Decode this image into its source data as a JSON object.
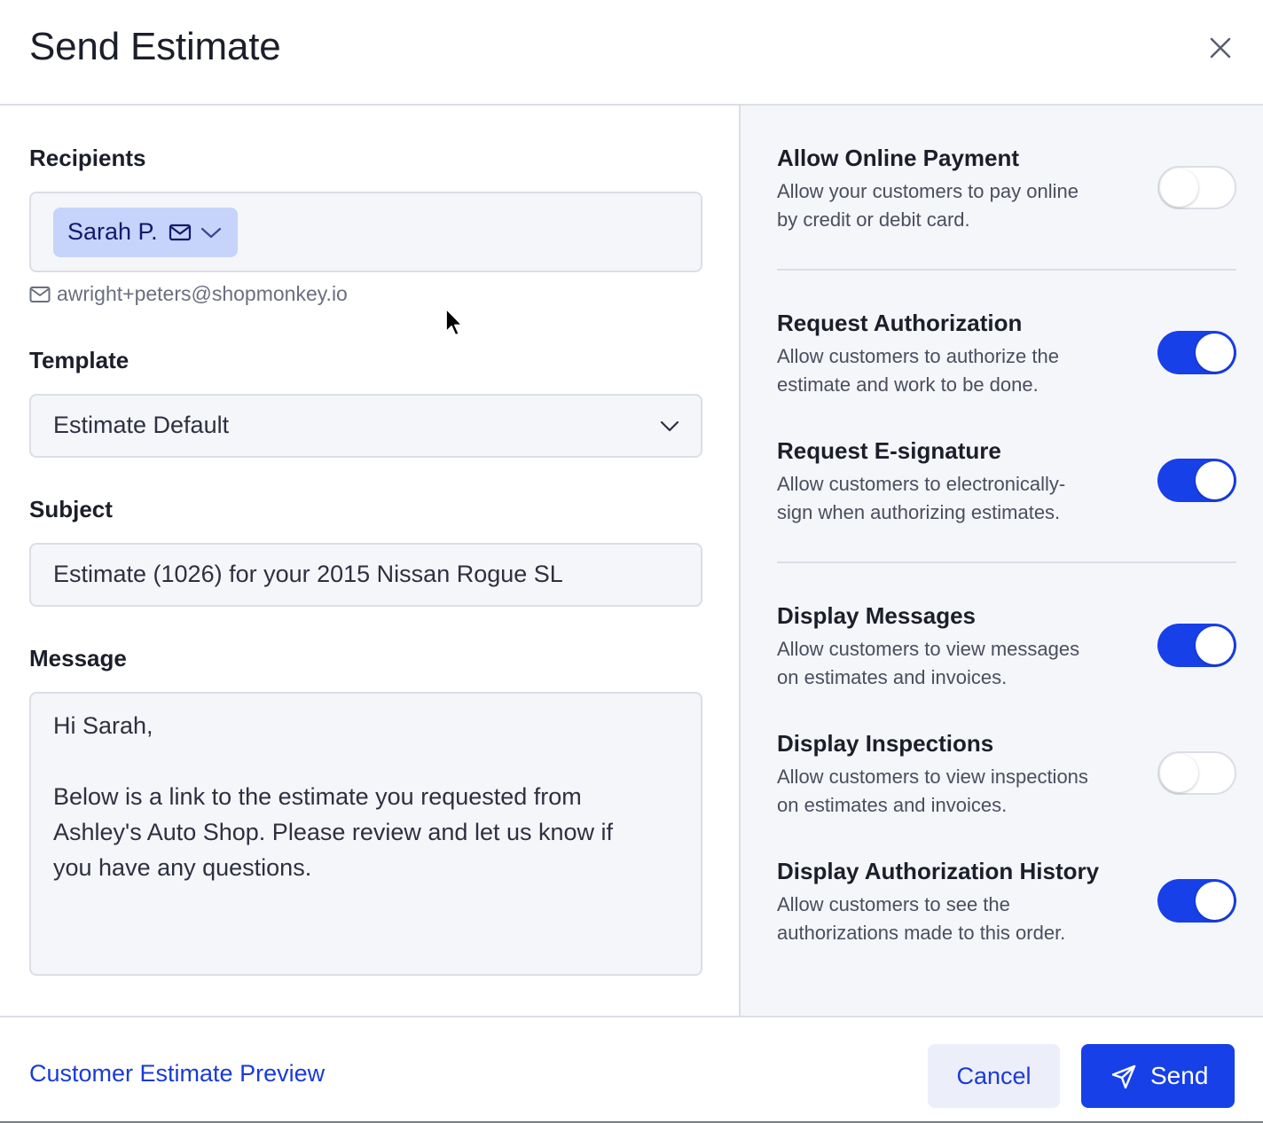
{
  "dialog": {
    "title": "Send Estimate",
    "close_icon": "close-icon"
  },
  "recipients": {
    "label": "Recipients",
    "chip_name": "Sarah P.",
    "chip_icons": [
      "envelope-icon",
      "chevron-down-icon"
    ],
    "email": "awright+peters@shopmonkey.io"
  },
  "template": {
    "label": "Template",
    "value": "Estimate Default"
  },
  "subject": {
    "label": "Subject",
    "value": "Estimate (1026) for your 2015 Nissan Rogue SL"
  },
  "message": {
    "label": "Message",
    "lines": [
      "Hi Sarah,",
      "",
      "Below is a link to the estimate you requested from",
      "Ashley's Auto Shop. Please review and let us know if",
      "you have any questions."
    ]
  },
  "options": [
    {
      "title": "Allow Online Payment",
      "desc": [
        "Allow your customers to pay online",
        "by credit or debit card."
      ],
      "enabled": false
    },
    {
      "title": "Request Authorization",
      "desc": [
        "Allow customers to authorize the",
        "estimate and work to be done."
      ],
      "enabled": true
    },
    {
      "title": "Request E-signature",
      "desc": [
        "Allow customers to electronically-",
        "sign when authorizing estimates."
      ],
      "enabled": true
    },
    {
      "title": "Display Messages",
      "desc": [
        "Allow customers to view messages",
        "on estimates and invoices."
      ],
      "enabled": true
    },
    {
      "title": "Display Inspections",
      "desc": [
        "Allow customers to view inspections",
        "on estimates and invoices."
      ],
      "enabled": false
    },
    {
      "title": "Display Authorization History",
      "desc": [
        "Allow customers to see the",
        "authorizations made to this order."
      ],
      "enabled": true
    }
  ],
  "footer": {
    "preview_link": "Customer Estimate Preview",
    "cancel_label": "Cancel",
    "send_label": "Send",
    "send_icon": "paper-plane-icon"
  },
  "colors": {
    "accent": "#1740e8",
    "link": "#1a3bd6",
    "chip_bg": "#c6d3fb",
    "panel_bg": "#f5f6fa"
  }
}
